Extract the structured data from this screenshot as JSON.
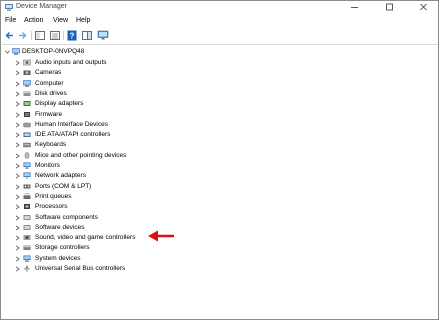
{
  "window": {
    "title": "Device Manager"
  },
  "menu": [
    "File",
    "Action",
    "View",
    "Help"
  ],
  "root": {
    "label": "DESKTOP-0NVPQ48"
  },
  "categories": [
    {
      "label": "Audio inputs and outputs",
      "icon": "speaker-icon"
    },
    {
      "label": "Cameras",
      "icon": "camera-icon"
    },
    {
      "label": "Computer",
      "icon": "computer-icon"
    },
    {
      "label": "Disk drives",
      "icon": "disk-icon"
    },
    {
      "label": "Display adapters",
      "icon": "display-icon"
    },
    {
      "label": "Firmware",
      "icon": "chip-icon"
    },
    {
      "label": "Human Interface Devices",
      "icon": "hid-icon"
    },
    {
      "label": "IDE ATA/ATAPI controllers",
      "icon": "controller-icon"
    },
    {
      "label": "Keyboards",
      "icon": "keyboard-icon"
    },
    {
      "label": "Mice and other pointing devices",
      "icon": "mouse-icon"
    },
    {
      "label": "Monitors",
      "icon": "monitor-icon"
    },
    {
      "label": "Network adapters",
      "icon": "network-icon"
    },
    {
      "label": "Ports (COM & LPT)",
      "icon": "port-icon"
    },
    {
      "label": "Print queues",
      "icon": "printer-icon"
    },
    {
      "label": "Processors",
      "icon": "processor-icon"
    },
    {
      "label": "Software components",
      "icon": "software-icon"
    },
    {
      "label": "Software devices",
      "icon": "software-icon"
    },
    {
      "label": "Sound, video and game controllers",
      "icon": "sound-icon"
    },
    {
      "label": "Storage controllers",
      "icon": "storage-icon"
    },
    {
      "label": "System devices",
      "icon": "system-icon"
    },
    {
      "label": "Universal Serial Bus controllers",
      "icon": "usb-icon"
    }
  ],
  "colors": {
    "accent": "#1a73c8",
    "annotation_arrow": "#e01010"
  }
}
